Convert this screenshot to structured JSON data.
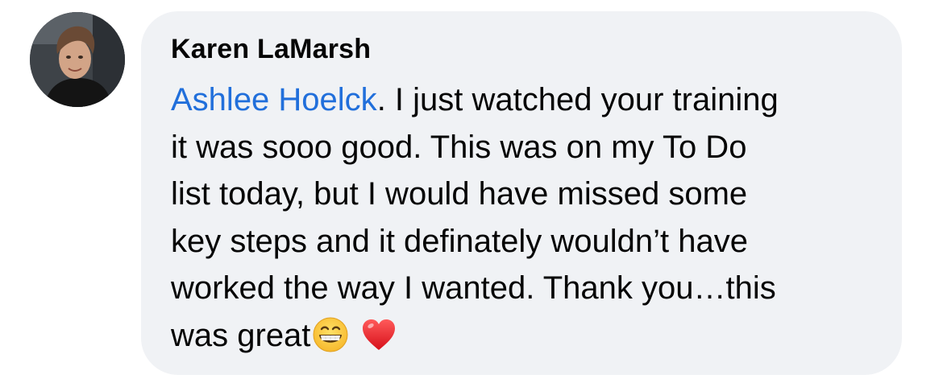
{
  "comment": {
    "author": "Karen LaMarsh",
    "mention": "Ashlee Hoelck",
    "lines": [
      ". I just watched your training",
      "it was sooo good.  This was on my To Do",
      "list today, but I would have missed some",
      "key steps and it definately wouldn’t have",
      "worked the way I wanted. Thank you…this",
      "was great"
    ],
    "emojis": [
      "grinning-face-emoji",
      "red-heart-emoji"
    ]
  },
  "colors": {
    "bubble_background": "#f0f2f5",
    "mention_link": "#216fdb",
    "text": "#050505"
  }
}
